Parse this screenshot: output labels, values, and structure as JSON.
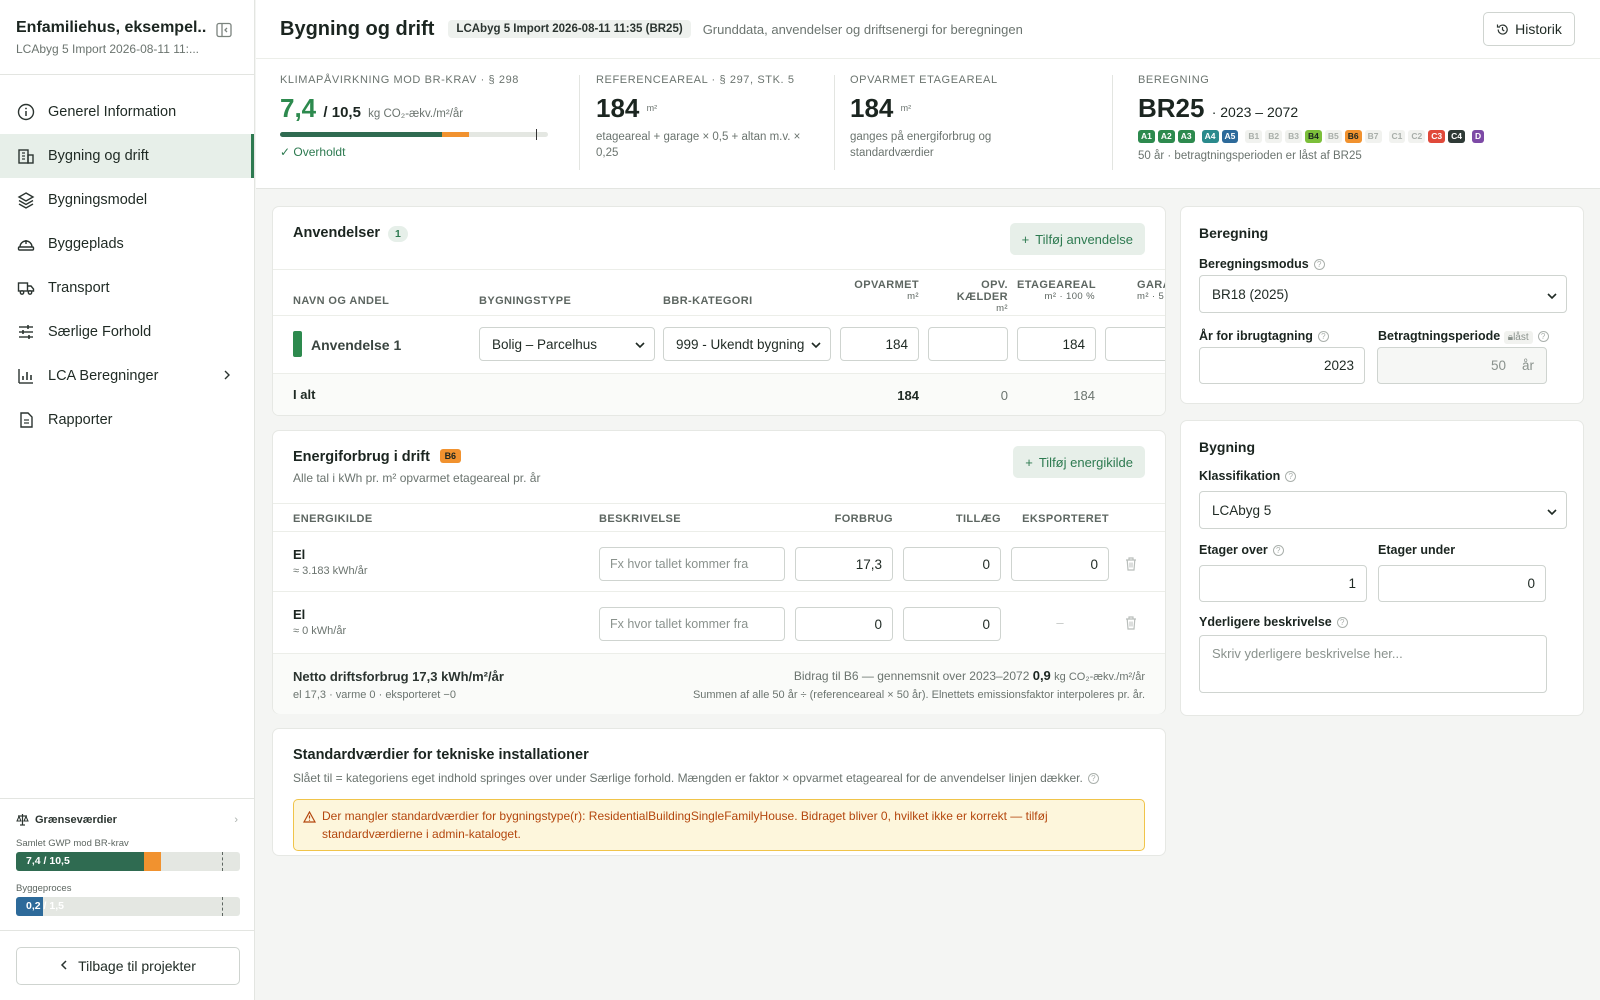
{
  "sidebar": {
    "project_title": "Enfamiliehus, eksempel...",
    "project_sub": "LCAbyg 5 Import 2026-08-11 11:...",
    "nav": [
      {
        "label": "Generel Information",
        "icon": "info-icon"
      },
      {
        "label": "Bygning og drift",
        "icon": "building-icon",
        "active": true
      },
      {
        "label": "Bygningsmodel",
        "icon": "layers-icon"
      },
      {
        "label": "Byggeplads",
        "icon": "hardhat-icon"
      },
      {
        "label": "Transport",
        "icon": "truck-icon"
      },
      {
        "label": "Særlige Forhold",
        "icon": "sliders-icon"
      },
      {
        "label": "LCA Beregninger",
        "icon": "barchart-icon"
      },
      {
        "label": "Rapporter",
        "icon": "document-icon"
      }
    ],
    "limits": {
      "title": "Grænseværdier",
      "gwp_label": "Samlet GWP mod BR-krav",
      "gwp_text": "7,4 / 10,5",
      "gwp_fraction": 0.705,
      "process_label": "Byggeproces",
      "process_text": "0,2 / 1,5",
      "process_fraction": 0.13
    },
    "back_label": "Tilbage til projekter"
  },
  "header": {
    "title": "Bygning og drift",
    "chip": "LCAbyg 5 Import 2026-08-11 11:35 (BR25)",
    "subtitle": "Grunddata, anvendelser og driftsenergi for beregningen",
    "history_label": "Historik"
  },
  "stats": {
    "gwp": {
      "label": "Klimapåvirkning mod BR-krav · § 298",
      "value": "7,4",
      "limit": "/ 10,5",
      "unit": "kg CO₂-ækv./m²/år",
      "status": "Overholdt",
      "fraction": 0.705
    },
    "ref": {
      "label": "Referenceareal · § 297, stk. 5",
      "value": "184",
      "unit": "m²",
      "desc": "etageareal + garage × 0,5 + altan m.v. × 0,25"
    },
    "heated": {
      "label": "Opvarmet etageareal",
      "value": "184",
      "unit": "m²",
      "desc": "ganges på energiforbrug og standardværdier"
    },
    "calc": {
      "label": "Beregning",
      "value": "BR25",
      "period": "· 2023 – 2072",
      "desc": "50 år · betragtningsperioden er låst af BR25",
      "phases": [
        {
          "code": "A1",
          "bg": "#2d8a4e",
          "fg": "#ffffff"
        },
        {
          "code": "A2",
          "bg": "#2d8a4e",
          "fg": "#ffffff"
        },
        {
          "code": "A3",
          "bg": "#2d8a4e",
          "fg": "#ffffff"
        },
        {
          "code": "A4",
          "bg": "#2a8a8c",
          "fg": "#ffffff"
        },
        {
          "code": "A5",
          "bg": "#2d6a9a",
          "fg": "#ffffff"
        },
        {
          "code": "B1",
          "bg": "#f1f2ef",
          "fg": "#a8aea9"
        },
        {
          "code": "B2",
          "bg": "#f1f2ef",
          "fg": "#a8aea9"
        },
        {
          "code": "B3",
          "bg": "#f1f2ef",
          "fg": "#a8aea9"
        },
        {
          "code": "B4",
          "bg": "#7cbf3a",
          "fg": "#1b2520"
        },
        {
          "code": "B5",
          "bg": "#f1f2ef",
          "fg": "#a8aea9"
        },
        {
          "code": "B6",
          "bg": "#f1922f",
          "fg": "#1b2520"
        },
        {
          "code": "B7",
          "bg": "#f1f2ef",
          "fg": "#a8aea9"
        },
        {
          "code": "C1",
          "bg": "#f1f2ef",
          "fg": "#a8aea9"
        },
        {
          "code": "C2",
          "bg": "#f1f2ef",
          "fg": "#a8aea9"
        },
        {
          "code": "C3",
          "bg": "#e0493a",
          "fg": "#ffffff"
        },
        {
          "code": "C4",
          "bg": "#2f3a36",
          "fg": "#ffffff"
        },
        {
          "code": "D",
          "bg": "#7d4aa6",
          "fg": "#ffffff"
        }
      ]
    }
  },
  "uses": {
    "title": "Anvendelser",
    "count": "1",
    "add_label": "Tilføj anvendelse",
    "columns": {
      "name": "NAVN OG ANDEL",
      "type": "BYGNINGSTYPE",
      "bbr": "BBR-KATEGORI",
      "heated": "OPVARMET",
      "heated_u": "m²",
      "basement": "OPV. KÆLDER",
      "basement_u": "m²",
      "floor": "ETAGEAREAL",
      "floor_u": "m² · 100 %",
      "garage": "GARA",
      "garage_u": "m² · 5"
    },
    "row": {
      "name": "Anvendelse 1",
      "type": "Bolig – Parcelhus",
      "bbr": "999 - Ukendt bygning",
      "heated": "184",
      "basement": "",
      "floor": "184"
    },
    "total": {
      "label": "I alt",
      "heated": "184",
      "basement": "0",
      "floor": "184"
    }
  },
  "energy": {
    "title": "Energiforbrug i drift",
    "badge": "B6",
    "subtitle": "Alle tal i kWh pr. m² opvarmet etageareal pr. år",
    "add_label": "Tilføj energikilde",
    "columns": {
      "source": "ENERGIKILDE",
      "desc": "BESKRIVELSE",
      "use": "FORBRUG",
      "extra": "TILLÆG",
      "export": "EKSPORTERET"
    },
    "rows": [
      {
        "source": "El",
        "sub": "≈ 3.183 kWh/år",
        "placeholder": "Fx hvor tallet kommer fra",
        "use": "17,3",
        "extra": "0",
        "export": "0"
      },
      {
        "source": "El",
        "sub": "≈ 0 kWh/år",
        "placeholder": "Fx hvor tallet kommer fra",
        "use": "0",
        "extra": "0",
        "export": "–"
      }
    ],
    "net_label": "Netto driftsforbrug 17,3 kWh/m²/år",
    "net_sub": "el 17,3 · varme 0 · eksporteret −0",
    "contrib_prefix": "Bidrag til B6 — gennemsnit over 2023–2072",
    "contrib_value": "0,9",
    "contrib_unit": "kg CO₂-ækv./m²/år",
    "contrib_note": "Summen af alle 50 år ÷ (referenceareal × 50 år). Elnettets emissionsfaktor interpoleres pr. år."
  },
  "standard": {
    "title": "Standardværdier for tekniske installationer",
    "desc": "Slået til = kategoriens eget indhold springes over under Særlige forhold. Mængden er faktor × opvarmet etageareal for de anvendelser linjen dækker.",
    "warning": "Der mangler standardværdier for bygningstype(r): ResidentialBuildingSingleFamilyHouse. Bidraget bliver 0, hvilket ikke er korrekt — tilføj standardværdierne i admin-kataloget."
  },
  "calc_panel": {
    "title": "Beregning",
    "mode_label": "Beregningsmodus",
    "mode_value": "BR18 (2025)",
    "year_label": "År for ibrugtagning",
    "year_value": "2023",
    "period_label": "Betragtningsperiode",
    "locked": "låst",
    "period_value": "50",
    "period_unit": "år"
  },
  "building_panel": {
    "title": "Bygning",
    "class_label": "Klassifikation",
    "class_value": "LCAbyg 5",
    "above_label": "Etager over",
    "above_value": "1",
    "below_label": "Etager under",
    "below_value": "0",
    "desc_label": "Yderligere beskrivelse",
    "desc_placeholder": "Skriv yderligere beskrivelse her..."
  }
}
